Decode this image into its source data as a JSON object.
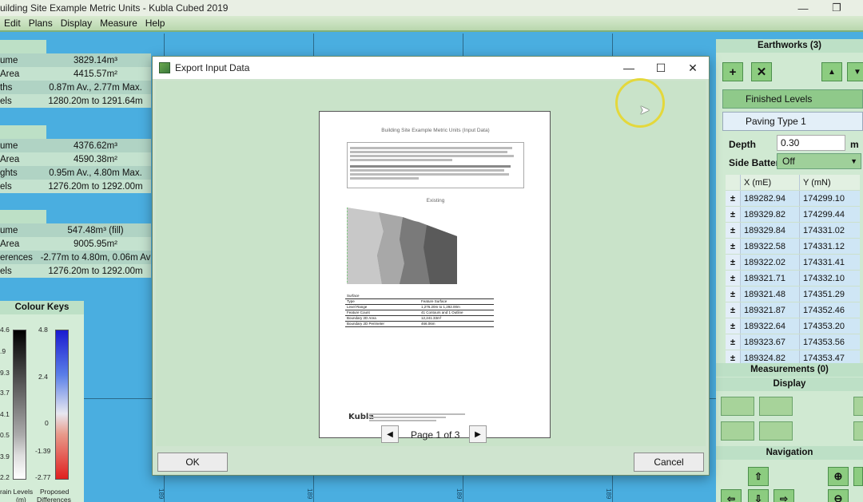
{
  "window": {
    "title": "uilding Site Example Metric Units - Kubla Cubed 2019",
    "minimize": "—",
    "restore": "❐"
  },
  "menu": [
    "Edit",
    "Plans",
    "Display",
    "Measure",
    "Help"
  ],
  "left_panel": {
    "group1": [
      {
        "label": "ume",
        "value": "3829.14m³"
      },
      {
        "label": "Area",
        "value": "4415.57m²"
      },
      {
        "label": "ths",
        "value": "0.87m Av., 2.77m Max."
      },
      {
        "label": "els",
        "value": "1280.20m to 1291.64m"
      }
    ],
    "group2": [
      {
        "label": "ume",
        "value": "4376.62m³"
      },
      {
        "label": "Area",
        "value": "4590.38m²"
      },
      {
        "label": "ghts",
        "value": "0.95m Av., 4.80m Max."
      },
      {
        "label": "els",
        "value": "1276.20m to 1292.00m"
      }
    ],
    "group3": [
      {
        "label": "ume",
        "value": "547.48m³ (fill)"
      },
      {
        "label": "Area",
        "value": "9005.95m²"
      },
      {
        "label": "erences",
        "value": "-2.77m to 4.80m, 0.06m Av"
      },
      {
        "label": "els",
        "value": "1276.20m to 1292.00m"
      }
    ]
  },
  "colour_keys": {
    "title": "Colour Keys",
    "gray_scale_labels": [
      "4.6",
      ".9",
      "9.3",
      "3.7",
      "4.1",
      "0.5",
      "3.9",
      "2.2"
    ],
    "diverging_labels": [
      "4.8",
      "2.4",
      "0",
      "-1.39",
      "-2.77"
    ],
    "caption_left": "rain Levels",
    "caption_left2": "(m)",
    "caption_right": "Proposed",
    "caption_right2": "Differences"
  },
  "right_panel": {
    "earthworks_header": "Earthworks (3)",
    "finished_levels": "Finished Levels",
    "paving_type": "Paving Type 1",
    "depth_label": "Depth",
    "depth_value": "0.30",
    "depth_unit": "m",
    "side_batter_label": "Side Batter",
    "side_batter_value": "Off",
    "col_x": "X (mE)",
    "col_y": "Y (mN)",
    "rows": [
      {
        "x": "189282.94",
        "y": "174299.10"
      },
      {
        "x": "189329.82",
        "y": "174299.44"
      },
      {
        "x": "189329.84",
        "y": "174331.02"
      },
      {
        "x": "189322.58",
        "y": "174331.12"
      },
      {
        "x": "189322.02",
        "y": "174331.41"
      },
      {
        "x": "189321.71",
        "y": "174332.10"
      },
      {
        "x": "189321.48",
        "y": "174351.29"
      },
      {
        "x": "189321.87",
        "y": "174352.46"
      },
      {
        "x": "189322.64",
        "y": "174353.20"
      },
      {
        "x": "189323.67",
        "y": "174353.56"
      },
      {
        "x": "189324.82",
        "y": "174353.47"
      }
    ],
    "pm": "±",
    "measurements_header": "Measurements (0)",
    "display_header": "Display",
    "navigation_header": "Navigation"
  },
  "dialog": {
    "title": "Export Input Data",
    "minimize": "—",
    "maximize": "☐",
    "close": "✕",
    "page_label": "Page 1 of 3",
    "ok": "OK",
    "cancel": "Cancel",
    "preview": {
      "heading": "Building Site Example Metric Units (Input Data)",
      "existing": "Existing",
      "logo": "Kubla",
      "table": [
        [
          "Surface",
          ""
        ],
        [
          "Type",
          "Feature Surface"
        ],
        [
          "Level Range",
          "1,276.20m to 1,292.00m"
        ],
        [
          "Feature Count",
          "41 Contours and 1 Outline"
        ],
        [
          "Boundary 2D Area",
          "12,241.33m²"
        ],
        [
          "Boundary 2D Perimeter",
          "466.06m"
        ]
      ]
    }
  },
  "bottom_ticks": [
    "189",
    "189",
    "189",
    "189",
    "189",
    "189"
  ]
}
